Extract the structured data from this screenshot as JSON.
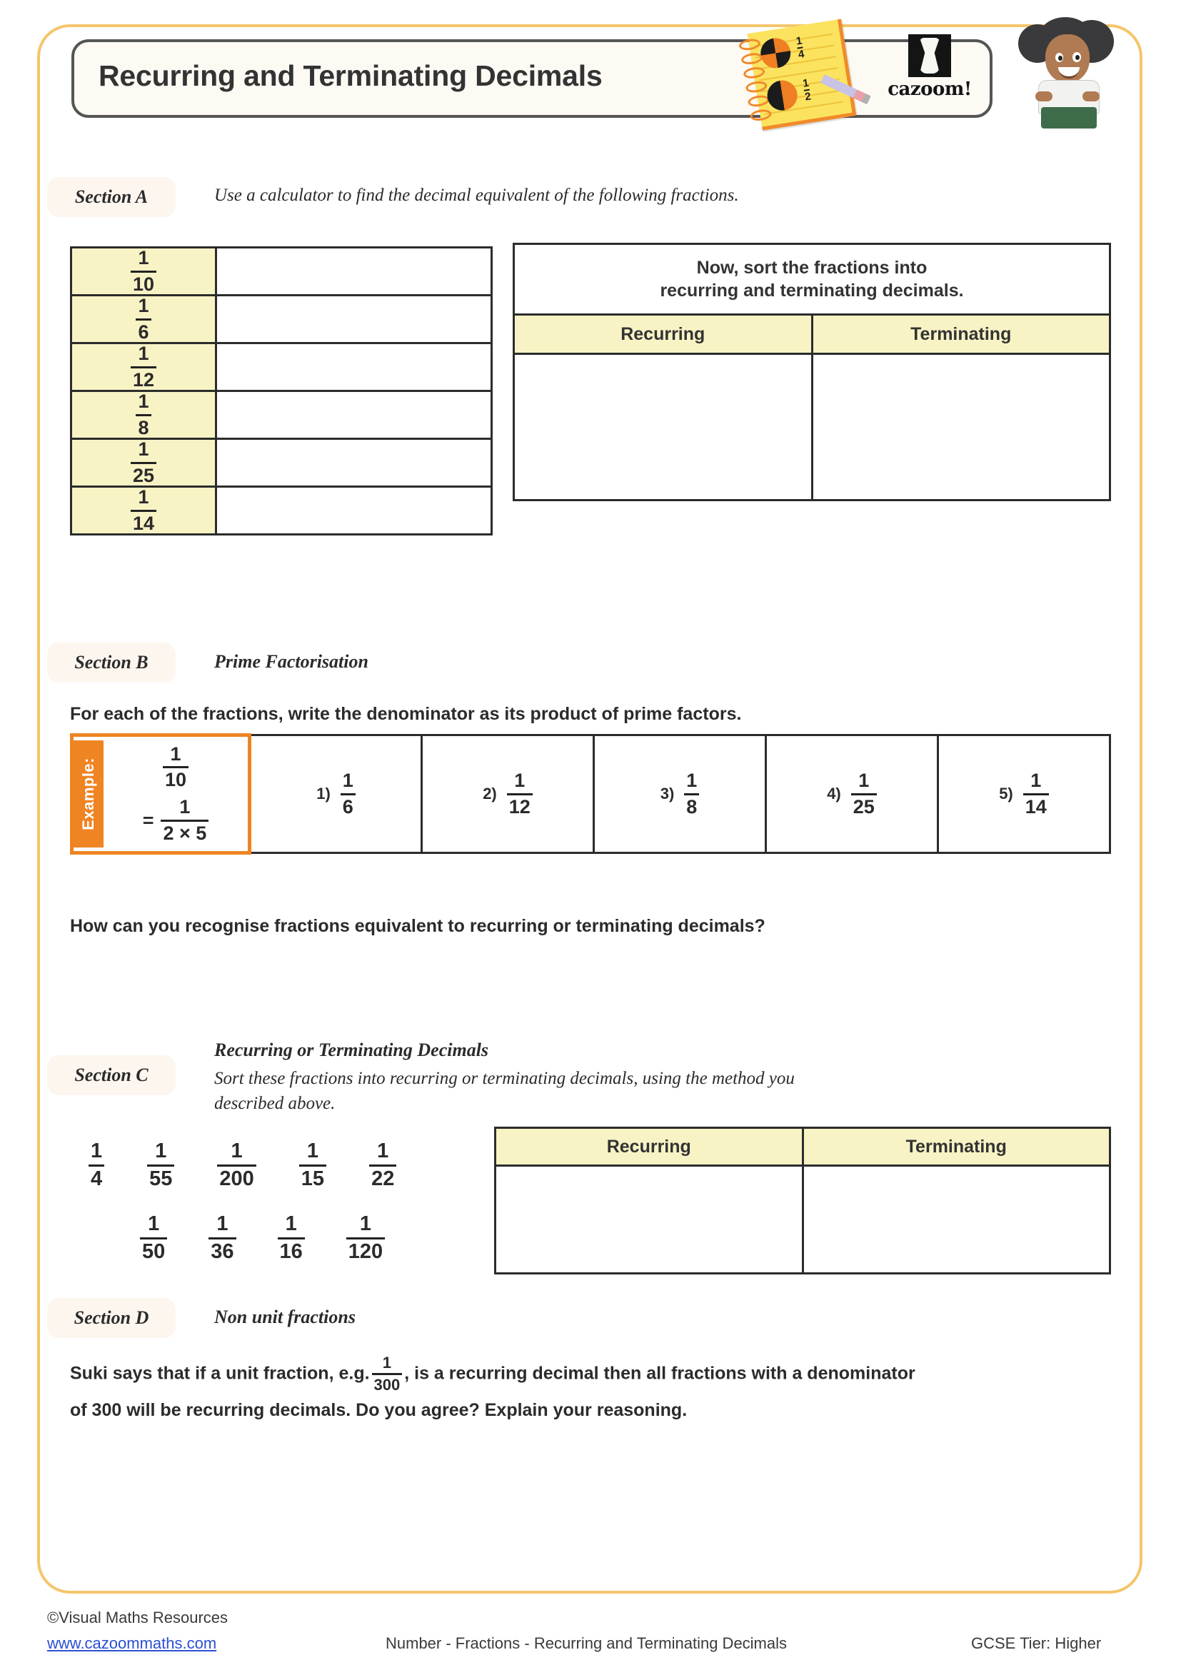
{
  "header": {
    "title": "Recurring and Terminating Decimals",
    "logo_word": "cazoom!",
    "notepad_fraction_1": {
      "num": "1",
      "den": "4"
    },
    "notepad_fraction_2": {
      "num": "1",
      "den": "2"
    }
  },
  "sections": {
    "a": {
      "label": "Section A",
      "instruction": "Use a calculator to find the decimal equivalent of the following fractions.",
      "fractions": [
        {
          "num": "1",
          "den": "10"
        },
        {
          "num": "1",
          "den": "6"
        },
        {
          "num": "1",
          "den": "12"
        },
        {
          "num": "1",
          "den": "8"
        },
        {
          "num": "1",
          "den": "25"
        },
        {
          "num": "1",
          "den": "14"
        }
      ],
      "sort_prompt_line1": "Now, sort the fractions into",
      "sort_prompt_line2": "recurring and terminating decimals.",
      "col_recurring": "Recurring",
      "col_terminating": "Terminating"
    },
    "b": {
      "label": "Section B",
      "title": "Prime Factorisation",
      "instruction": "For each of the fractions, write the denominator as its product of prime factors.",
      "example_label": "Example:",
      "example_fraction": {
        "num": "1",
        "den": "10"
      },
      "example_equals": "=",
      "example_result": {
        "num": "1",
        "den": "2 × 5"
      },
      "questions": [
        {
          "number": "1)",
          "num": "1",
          "den": "6"
        },
        {
          "number": "2)",
          "num": "1",
          "den": "12"
        },
        {
          "number": "3)",
          "num": "1",
          "den": "8"
        },
        {
          "number": "4)",
          "num": "1",
          "den": "25"
        },
        {
          "number": "5)",
          "num": "1",
          "den": "14"
        }
      ],
      "follow_up": "How can you recognise fractions equivalent to recurring or terminating decimals?"
    },
    "c": {
      "label": "Section C",
      "title": "Recurring or Terminating Decimals",
      "instruction_line1": "Sort these fractions into recurring or terminating decimals, using the method you",
      "instruction_line2": "described above.",
      "fractions_row1": [
        {
          "num": "1",
          "den": "4"
        },
        {
          "num": "1",
          "den": "55"
        },
        {
          "num": "1",
          "den": "200"
        },
        {
          "num": "1",
          "den": "15"
        },
        {
          "num": "1",
          "den": "22"
        }
      ],
      "fractions_row2": [
        {
          "num": "1",
          "den": "50"
        },
        {
          "num": "1",
          "den": "36"
        },
        {
          "num": "1",
          "den": "16"
        },
        {
          "num": "1",
          "den": "120"
        }
      ],
      "col_recurring": "Recurring",
      "col_terminating": "Terminating"
    },
    "d": {
      "label": "Section D",
      "title": "Non unit fractions",
      "text_before": "Suki says that if a unit fraction, e.g.",
      "inline_fraction": {
        "num": "1",
        "den": "300"
      },
      "text_after": ", is a recurring decimal then all fractions with a denominator",
      "text_line2": "of 300 will be recurring decimals. Do you agree? Explain your reasoning."
    }
  },
  "footer": {
    "copyright": "©Visual Maths Resources",
    "url": "www.cazoommaths.com",
    "topic": "Number - Fractions - Recurring and Terminating Decimals",
    "tier": "GCSE Tier: Higher"
  },
  "colors": {
    "frame": "#f5c56a",
    "cell_highlight": "#f8f3c5",
    "example_accent": "#ef8423",
    "pill": "#fdf6ef",
    "link": "#2b4fd4"
  }
}
